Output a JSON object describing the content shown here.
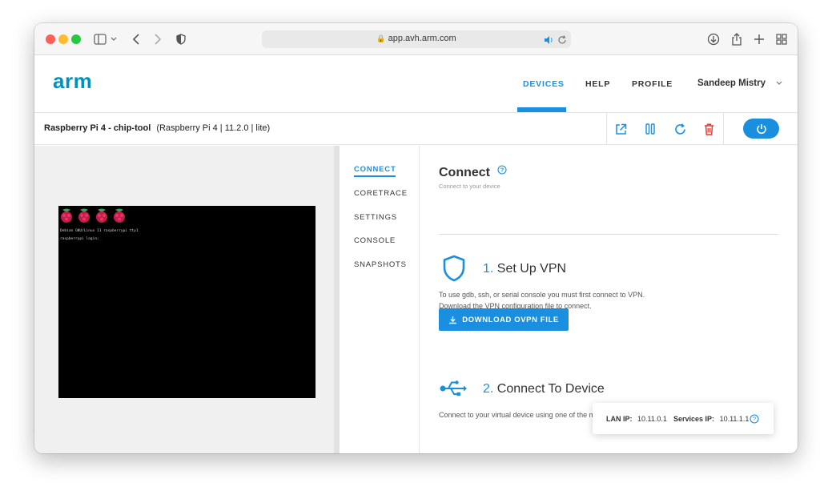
{
  "browser": {
    "url": "app.avh.arm.com"
  },
  "header": {
    "logo": "arm",
    "nav": [
      {
        "label": "DEVICES",
        "active": true
      },
      {
        "label": "HELP",
        "active": false
      },
      {
        "label": "PROFILE",
        "active": false
      }
    ],
    "user": "Sandeep Mistry"
  },
  "device": {
    "name": "Raspberry Pi 4 - chip-tool",
    "details": "(Raspberry Pi 4 | 11.2.0 | lite)"
  },
  "terminal": {
    "lines": [
      "Debian GNU/Linux 11 raspberrypi tty1",
      "raspberrypi login:"
    ]
  },
  "side_nav": [
    {
      "label": "CONNECT",
      "active": true
    },
    {
      "label": "CORETRACE",
      "active": false
    },
    {
      "label": "SETTINGS",
      "active": false
    },
    {
      "label": "CONSOLE",
      "active": false
    },
    {
      "label": "SNAPSHOTS",
      "active": false
    }
  ],
  "connect": {
    "title": "Connect",
    "subtitle": "Connect to your device",
    "step1": {
      "number": "1.",
      "title": "Set Up VPN",
      "text": "To use gdb, ssh, or serial console you must first connect to VPN. Download the VPN configuration file to connect.",
      "button": "DOWNLOAD OVPN FILE"
    },
    "step2": {
      "number": "2.",
      "title": "Connect To Device",
      "text": "Connect to your virtual device using one of the methods below."
    }
  },
  "ip_card": {
    "lan_label": "LAN IP:",
    "lan_value": "10.11.0.1",
    "services_label": "Services IP:",
    "services_value": "10.11.1.1"
  },
  "colors": {
    "accent": "#1a8fe0",
    "brand": "#0091bd",
    "delete": "#e53935"
  }
}
